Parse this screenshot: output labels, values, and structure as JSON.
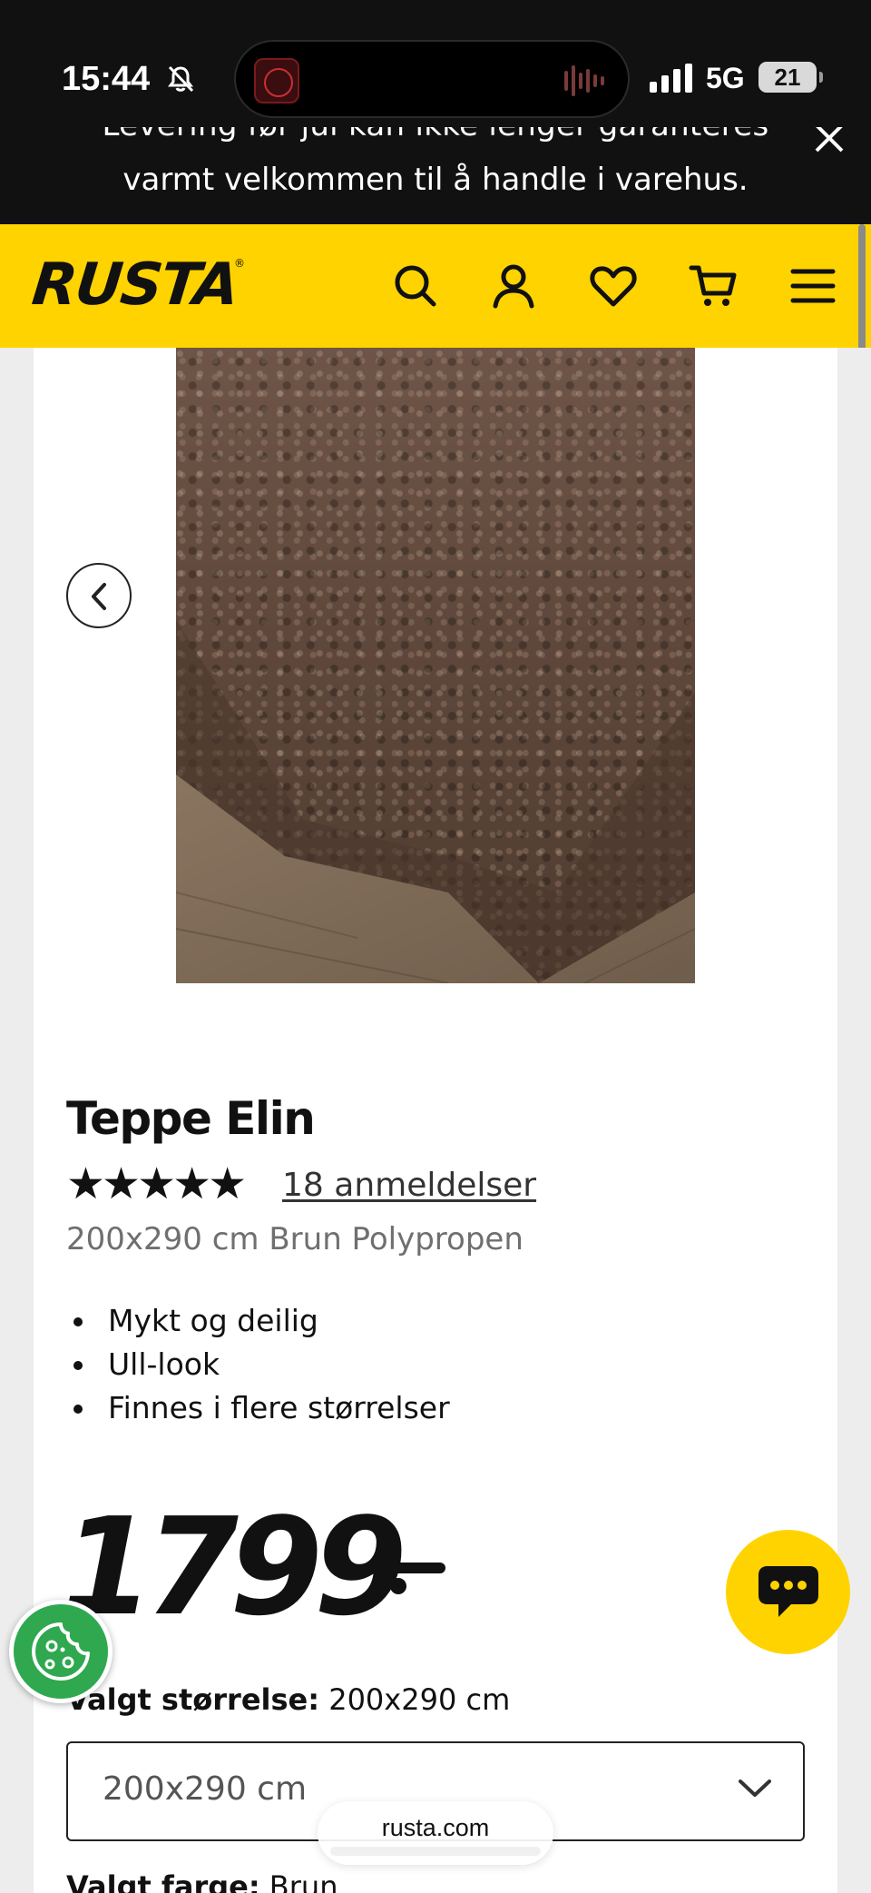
{
  "status_bar": {
    "time": "15:44",
    "network": "5G",
    "battery": "21",
    "icons": [
      "bell-off-icon",
      "signal-icon",
      "battery-icon"
    ]
  },
  "banner": {
    "partial_line": "Levering før jul kan ikke lenger garanteres",
    "text": "varmt velkommen til å handle i varehus.",
    "close_icon": "close-icon"
  },
  "header": {
    "logo": "RUSTA",
    "logo_mark": "®",
    "icons": [
      "search-icon",
      "account-icon",
      "heart-icon",
      "cart-icon",
      "menu-icon"
    ],
    "accent_color": "#ffd300"
  },
  "product": {
    "title": "Teppe Elin",
    "rating": 5,
    "stars_display": "★★★★★",
    "reviews": "18 anmeldelser",
    "subtitle": "200x290 cm Brun Polypropen",
    "features": [
      "Mykt og deilig",
      "Ull-look",
      "Finnes i flere størrelser"
    ],
    "price": "1799"
  },
  "size": {
    "label": "Valgt størrelse:",
    "value": "200x290 cm",
    "selected_option": "200x290 cm"
  },
  "color": {
    "label": "Valgt farge:",
    "value": "Brun"
  },
  "browser": {
    "url": "rusta.com"
  }
}
